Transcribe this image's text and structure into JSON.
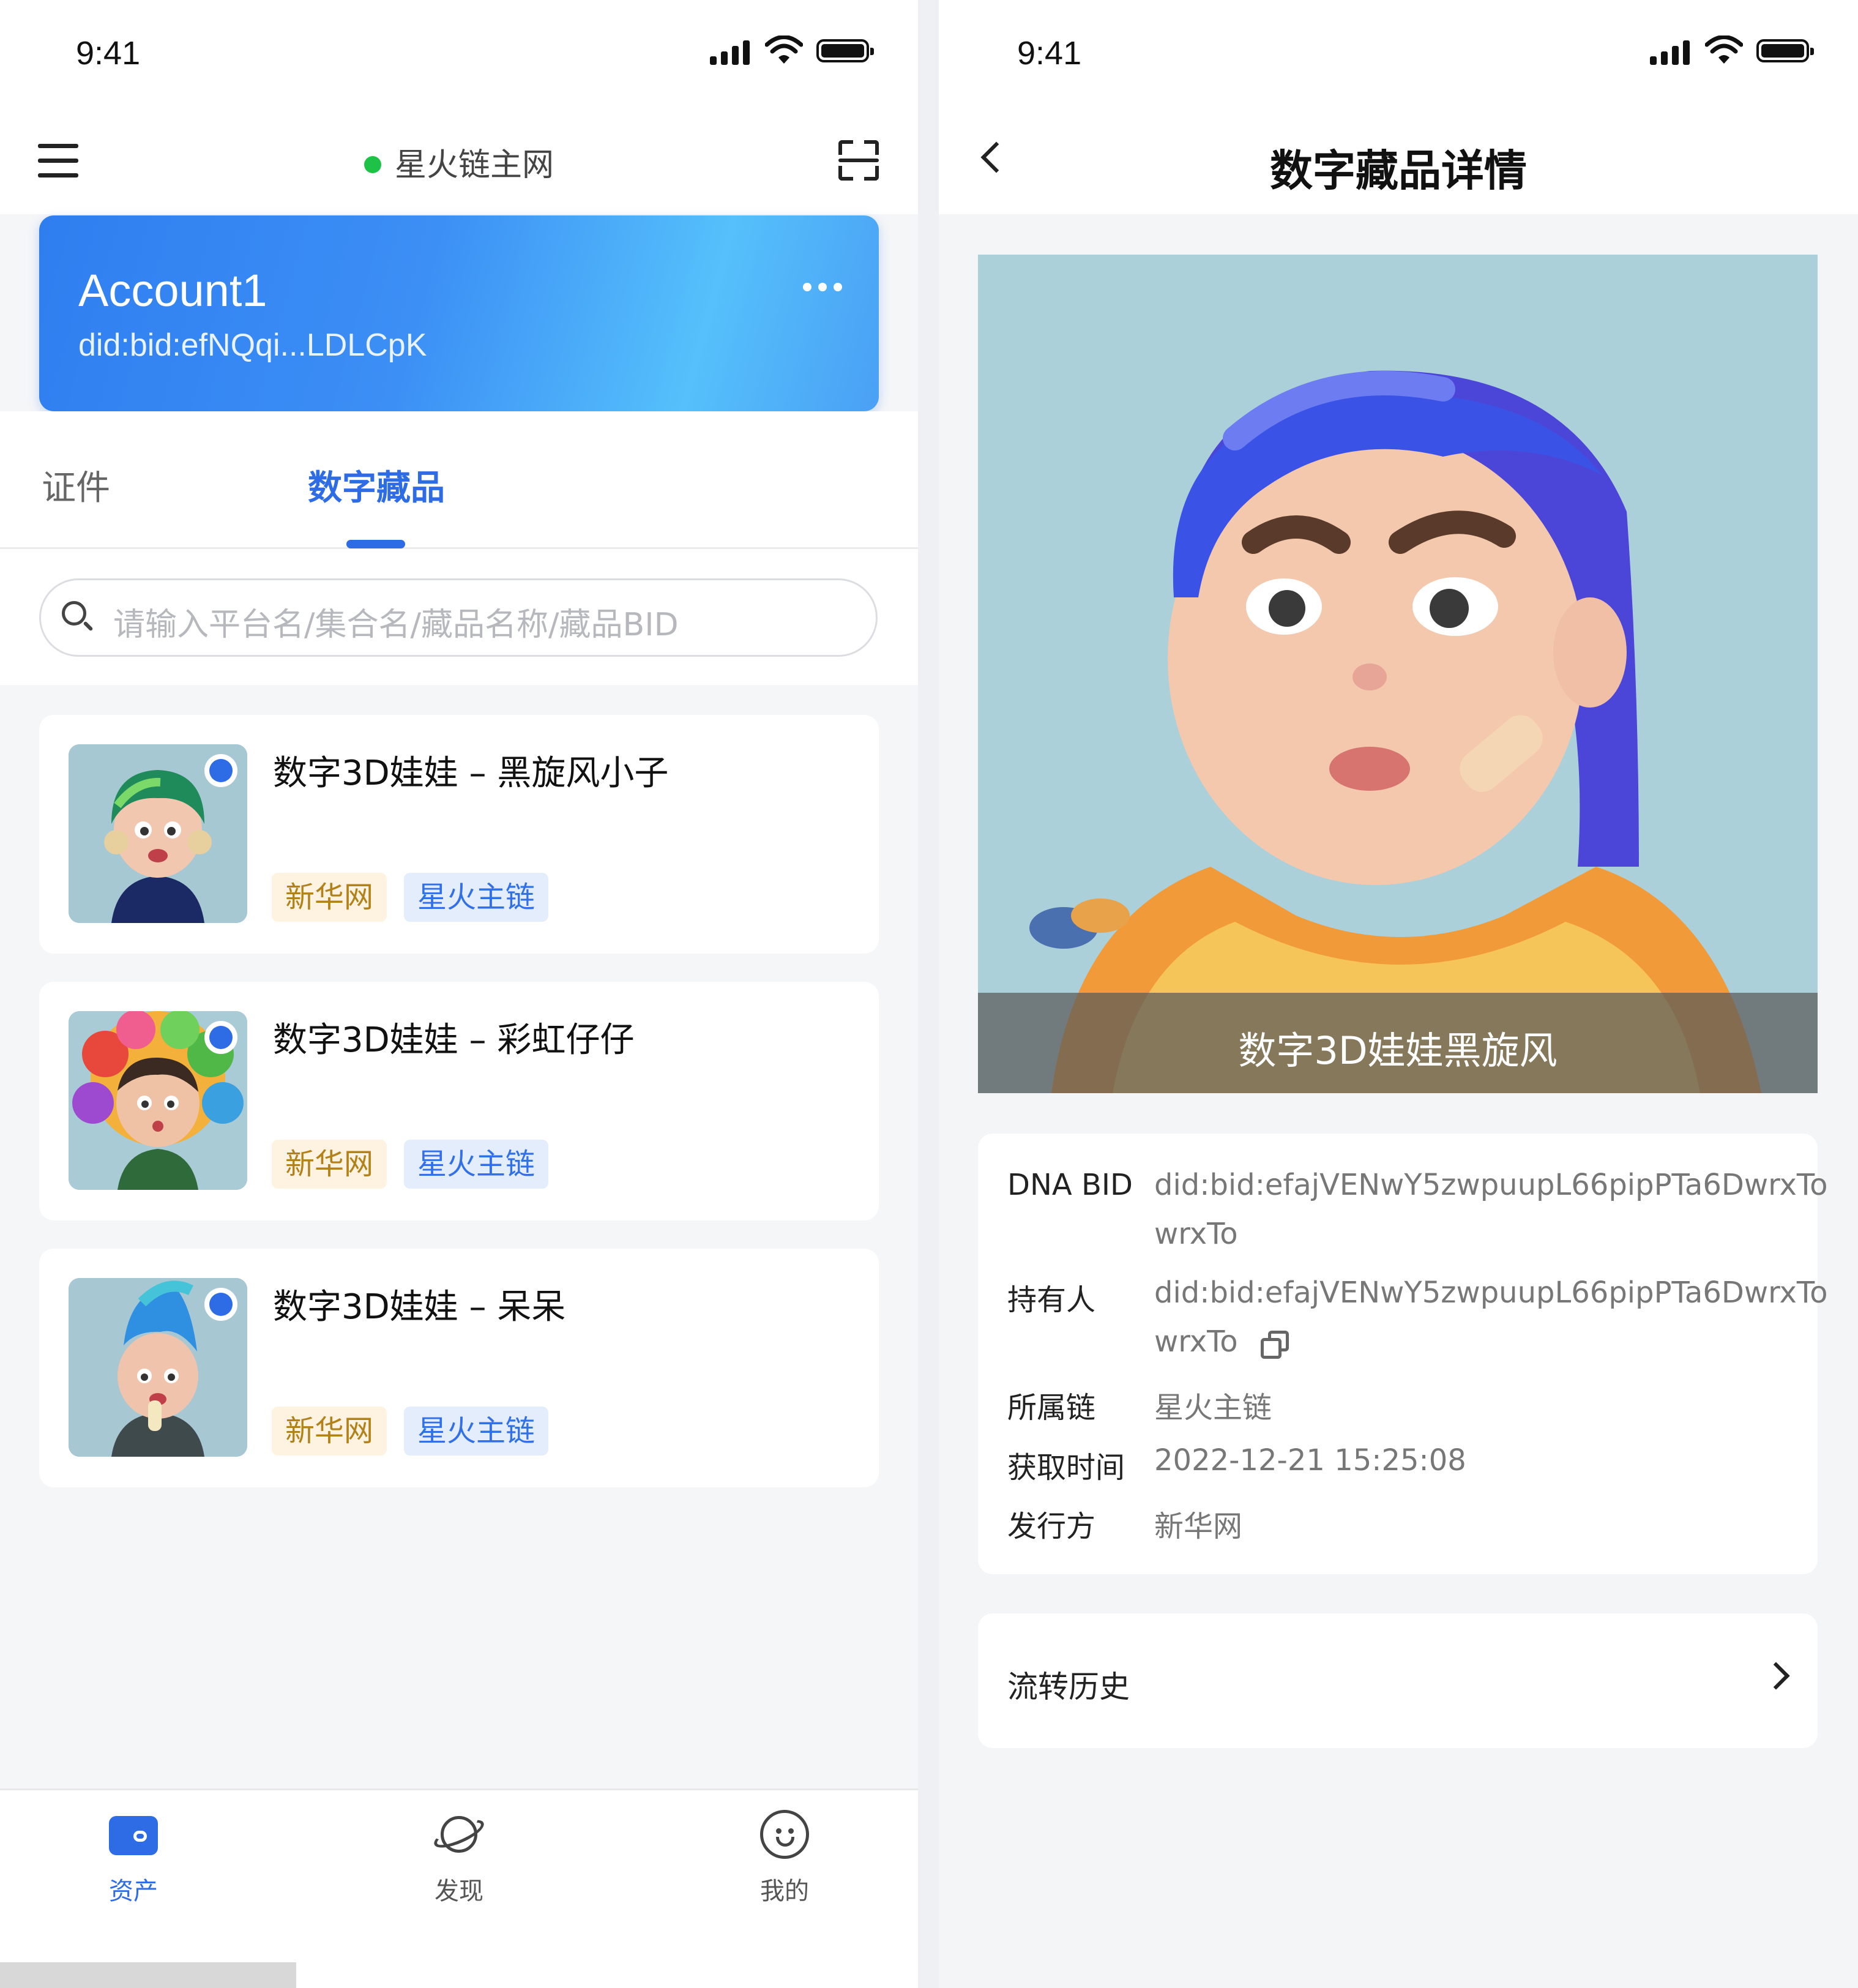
{
  "left": {
    "status": {
      "time": "9:41"
    },
    "header": {
      "network_label": "星火链主网"
    },
    "account": {
      "name": "Account1",
      "did": "did:bid:efNQqi...LDLCpK"
    },
    "tabs": [
      {
        "label": "证件",
        "active": false
      },
      {
        "label": "数字藏品",
        "active": true
      }
    ],
    "search": {
      "placeholder": "请输入平台名/集合名/藏品名称/藏品BID"
    },
    "items": [
      {
        "title": "数字3D娃娃 – 黑旋风小子",
        "issuer_tag": "新华网",
        "chain_tag": "星火主链",
        "icon": "doll-avatar"
      },
      {
        "title": "数字3D娃娃 – 彩虹仔仔",
        "issuer_tag": "新华网",
        "chain_tag": "星火主链",
        "icon": "doll-avatar"
      },
      {
        "title": "数字3D娃娃 – 呆呆",
        "issuer_tag": "新华网",
        "chain_tag": "星火主链",
        "icon": "doll-avatar"
      }
    ],
    "tabbar": [
      {
        "label": "资产",
        "icon": "wallet-icon",
        "active": true
      },
      {
        "label": "发现",
        "icon": "planet-icon",
        "active": false
      },
      {
        "label": "我的",
        "icon": "face-icon",
        "active": false
      }
    ]
  },
  "right": {
    "status": {
      "time": "9:41"
    },
    "header": {
      "title": "数字藏品详情"
    },
    "hero": {
      "caption": "数字3D娃娃黑旋风"
    },
    "details": {
      "dna_bid_label": "DNA BID",
      "dna_bid_line1": "did:bid:efajVENwY5zwpuupL66pipPTa6DwrxTo",
      "dna_bid_line2": "wrxTo",
      "owner_label": "持有人",
      "owner_line1": "did:bid:efajVENwY5zwpuupL66pipPTa6DwrxTo",
      "owner_line2": "wrxTo",
      "chain_label": "所属链",
      "chain_value": "星火主链",
      "time_label": "获取时间",
      "time_value": "2022-12-21 15:25:08",
      "issuer_label": "发行方",
      "issuer_value": "新华网"
    },
    "history": {
      "label": "流转历史"
    }
  },
  "colors": {
    "accent": "#2e6ce6",
    "online_dot": "#1ec246",
    "issuer_tag_bg": "#fdf3e0",
    "issuer_tag_text": "#b38119",
    "chain_tag_bg": "#e4edfc",
    "chain_tag_text": "#3170e6"
  }
}
